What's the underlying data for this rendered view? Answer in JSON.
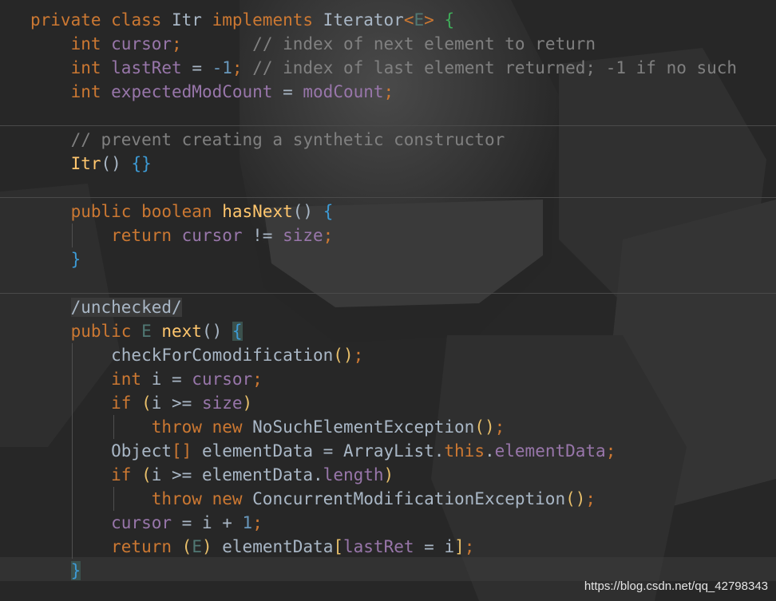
{
  "lines": [
    {
      "top_text": "private class Itr implements Iterator<E> {",
      "tokens": [
        {
          "t": "private ",
          "c": "kw"
        },
        {
          "t": "class ",
          "c": "kw"
        },
        {
          "t": "Itr ",
          "c": "plain"
        },
        {
          "t": "implements ",
          "c": "kw"
        },
        {
          "t": "Iterator",
          "c": "plain"
        },
        {
          "t": "<",
          "c": "kw"
        },
        {
          "t": "E",
          "c": "tp"
        },
        {
          "t": "> ",
          "c": "kw"
        },
        {
          "t": "{",
          "c": "brcG"
        }
      ]
    },
    {
      "tokens": [
        {
          "t": "    int ",
          "c": "kw"
        },
        {
          "t": "cursor",
          "c": "fld"
        },
        {
          "t": ";",
          "c": "kw"
        },
        {
          "t": "       // index of next element to return",
          "c": "cmt"
        }
      ]
    },
    {
      "tokens": [
        {
          "t": "    int ",
          "c": "kw"
        },
        {
          "t": "lastRet",
          "c": "fld"
        },
        {
          "t": " = ",
          "c": "plain"
        },
        {
          "t": "-1",
          "c": "num"
        },
        {
          "t": ";",
          "c": "kw"
        },
        {
          "t": " // index of last element returned; -1 if no such",
          "c": "cmt"
        }
      ]
    },
    {
      "tokens": [
        {
          "t": "    int ",
          "c": "kw"
        },
        {
          "t": "expectedModCount",
          "c": "fld"
        },
        {
          "t": " = ",
          "c": "plain"
        },
        {
          "t": "modCount",
          "c": "fld"
        },
        {
          "t": ";",
          "c": "kw"
        }
      ]
    },
    {
      "tokens": []
    },
    {
      "tokens": [
        {
          "t": "    // prevent creating a synthetic constructor",
          "c": "cmt"
        }
      ]
    },
    {
      "tokens": [
        {
          "t": "    ",
          "c": "plain"
        },
        {
          "t": "Itr",
          "c": "fn"
        },
        {
          "t": "() ",
          "c": "plain"
        },
        {
          "t": "{}",
          "c": "brcB"
        }
      ]
    },
    {
      "tokens": []
    },
    {
      "tokens": [
        {
          "t": "    public ",
          "c": "kw"
        },
        {
          "t": "boolean ",
          "c": "kw"
        },
        {
          "t": "hasNext",
          "c": "fn"
        },
        {
          "t": "() ",
          "c": "plain"
        },
        {
          "t": "{",
          "c": "brcB"
        }
      ]
    },
    {
      "tokens": [
        {
          "t": "        return ",
          "c": "kw"
        },
        {
          "t": "cursor",
          "c": "fld"
        },
        {
          "t": " != ",
          "c": "plain"
        },
        {
          "t": "size",
          "c": "fld"
        },
        {
          "t": ";",
          "c": "kw"
        }
      ]
    },
    {
      "tokens": [
        {
          "t": "    ",
          "c": "plain"
        },
        {
          "t": "}",
          "c": "brcB"
        }
      ]
    },
    {
      "tokens": []
    },
    {
      "tokens": [
        {
          "t": "    ",
          "c": "plain"
        },
        {
          "t": "/unchecked/",
          "c": "anno"
        }
      ]
    },
    {
      "tokens": [
        {
          "t": "    public ",
          "c": "kw"
        },
        {
          "t": "E ",
          "c": "tp"
        },
        {
          "t": "next",
          "c": "fn"
        },
        {
          "t": "() ",
          "c": "plain"
        },
        {
          "t": "{",
          "c": "brcB match"
        }
      ]
    },
    {
      "tokens": [
        {
          "t": "        checkForComodification",
          "c": "plain"
        },
        {
          "t": "()",
          "c": "brcY"
        },
        {
          "t": ";",
          "c": "kw"
        }
      ]
    },
    {
      "tokens": [
        {
          "t": "        int ",
          "c": "kw"
        },
        {
          "t": "i = ",
          "c": "plain"
        },
        {
          "t": "cursor",
          "c": "fld"
        },
        {
          "t": ";",
          "c": "kw"
        }
      ]
    },
    {
      "tokens": [
        {
          "t": "        if ",
          "c": "kw"
        },
        {
          "t": "(",
          "c": "brcY"
        },
        {
          "t": "i >= ",
          "c": "plain"
        },
        {
          "t": "size",
          "c": "fld"
        },
        {
          "t": ")",
          "c": "brcY"
        }
      ]
    },
    {
      "tokens": [
        {
          "t": "            throw ",
          "c": "kw"
        },
        {
          "t": "new ",
          "c": "kw"
        },
        {
          "t": "NoSuchElementException",
          "c": "plain"
        },
        {
          "t": "()",
          "c": "brcY"
        },
        {
          "t": ";",
          "c": "kw"
        }
      ]
    },
    {
      "tokens": [
        {
          "t": "        Object",
          "c": "plain"
        },
        {
          "t": "[] ",
          "c": "kw"
        },
        {
          "t": "elementData = ArrayList.",
          "c": "plain"
        },
        {
          "t": "this",
          "c": "kw"
        },
        {
          "t": ".",
          "c": "plain"
        },
        {
          "t": "elementData",
          "c": "fld"
        },
        {
          "t": ";",
          "c": "kw"
        }
      ]
    },
    {
      "tokens": [
        {
          "t": "        if ",
          "c": "kw"
        },
        {
          "t": "(",
          "c": "brcY"
        },
        {
          "t": "i >= elementData.",
          "c": "plain"
        },
        {
          "t": "length",
          "c": "fld"
        },
        {
          "t": ")",
          "c": "brcY"
        }
      ]
    },
    {
      "tokens": [
        {
          "t": "            throw ",
          "c": "kw"
        },
        {
          "t": "new ",
          "c": "kw"
        },
        {
          "t": "ConcurrentModificationException",
          "c": "plain"
        },
        {
          "t": "()",
          "c": "brcY"
        },
        {
          "t": ";",
          "c": "kw"
        }
      ]
    },
    {
      "tokens": [
        {
          "t": "        cursor",
          "c": "fld"
        },
        {
          "t": " = i + ",
          "c": "plain"
        },
        {
          "t": "1",
          "c": "num"
        },
        {
          "t": ";",
          "c": "kw"
        }
      ]
    },
    {
      "tokens": [
        {
          "t": "        return ",
          "c": "kw"
        },
        {
          "t": "(",
          "c": "brcY"
        },
        {
          "t": "E",
          "c": "tp"
        },
        {
          "t": ")",
          "c": "brcY"
        },
        {
          "t": " elementData",
          "c": "plain"
        },
        {
          "t": "[",
          "c": "brcY"
        },
        {
          "t": "lastRet",
          "c": "fld"
        },
        {
          "t": " = i",
          "c": "plain"
        },
        {
          "t": "]",
          "c": "brcY"
        },
        {
          "t": ";",
          "c": "kw"
        }
      ]
    },
    {
      "tokens": [
        {
          "t": "    ",
          "c": "plain"
        },
        {
          "t": "}",
          "c": "brcB match"
        }
      ]
    }
  ],
  "watermark": "https://blog.csdn.net/qq_42798343",
  "colors": {
    "background": "#2b2b2b",
    "keyword": "#cc7832",
    "field": "#9876aa",
    "comment": "#808080",
    "number": "#6897bb",
    "method": "#ffc66d",
    "text": "#a9b7c6"
  }
}
